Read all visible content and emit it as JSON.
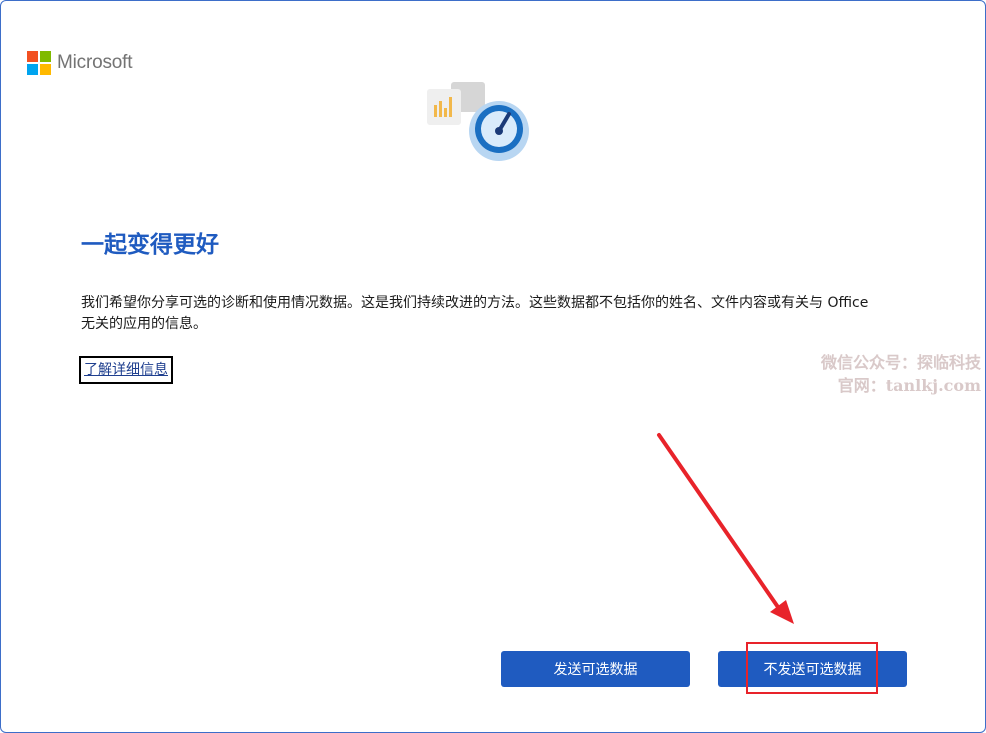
{
  "brand": {
    "name": "Microsoft",
    "colors": {
      "red": "#f25022",
      "green": "#7fba00",
      "blue": "#00a4ef",
      "yellow": "#ffb900"
    }
  },
  "page": {
    "title": "一起变得更好",
    "body": "我们希望你分享可选的诊断和使用情况数据。这是我们持续改进的方法。这些数据都不包括你的姓名、文件内容或有关与 Office 无关的应用的信息。",
    "learn_more": "了解详细信息"
  },
  "buttons": {
    "send_optional": "发送可选数据",
    "dont_send_optional": "不发送可选数据"
  },
  "watermark": {
    "line1": "微信公众号：探临科技",
    "line2": "官网：tanlkj.com"
  },
  "colors": {
    "accent": "#1f5bc0",
    "annotation": "#e8232a"
  },
  "icons": {
    "hero": "chart-and-speedometer-icon"
  }
}
